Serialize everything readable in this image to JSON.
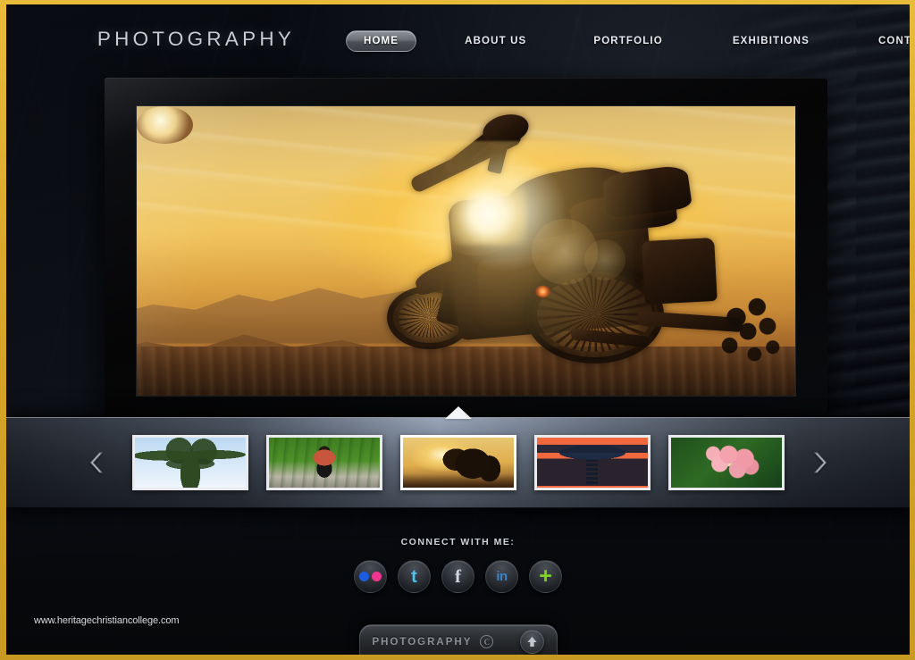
{
  "site": {
    "logo": "PHOTOGRAPHY",
    "watermark": "www.heritagechristiancollege.com",
    "frame_color": "#d8a82a"
  },
  "nav": {
    "items": [
      {
        "label": "HOME",
        "active": true
      },
      {
        "label": "ABOUT US",
        "active": false
      },
      {
        "label": "PORTFOLIO",
        "active": false
      },
      {
        "label": "EXHIBITIONS",
        "active": false
      },
      {
        "label": "CONTACT US",
        "active": false
      }
    ]
  },
  "hero": {
    "caption": "Motorcycle silhouetted against a golden sunset over distant mountains"
  },
  "slider": {
    "prev_icon": "chevron-left-icon",
    "next_icon": "chevron-right-icon",
    "active_index": 2,
    "thumbnails": [
      {
        "alt": "Palm tree against blue sky"
      },
      {
        "alt": "Rider on motorcycle on a green country road"
      },
      {
        "alt": "Motorcycle at sunset"
      },
      {
        "alt": "Tower structure on orange background"
      },
      {
        "alt": "Pink flowers with green leaves"
      }
    ]
  },
  "connect": {
    "label": "CONNECT WITH ME:",
    "socials": [
      {
        "name": "flickr",
        "icon": "flickr-icon",
        "glyph": ""
      },
      {
        "name": "twitter",
        "icon": "twitter-icon",
        "glyph": "t"
      },
      {
        "name": "facebook",
        "icon": "facebook-icon",
        "glyph": "f"
      },
      {
        "name": "linkedin",
        "icon": "linkedin-icon",
        "glyph": "in"
      },
      {
        "name": "share-more",
        "icon": "plus-icon",
        "glyph": "+"
      }
    ]
  },
  "dock": {
    "title": "PHOTOGRAPHY",
    "mark": "C",
    "up_icon": "arrow-up-icon"
  }
}
